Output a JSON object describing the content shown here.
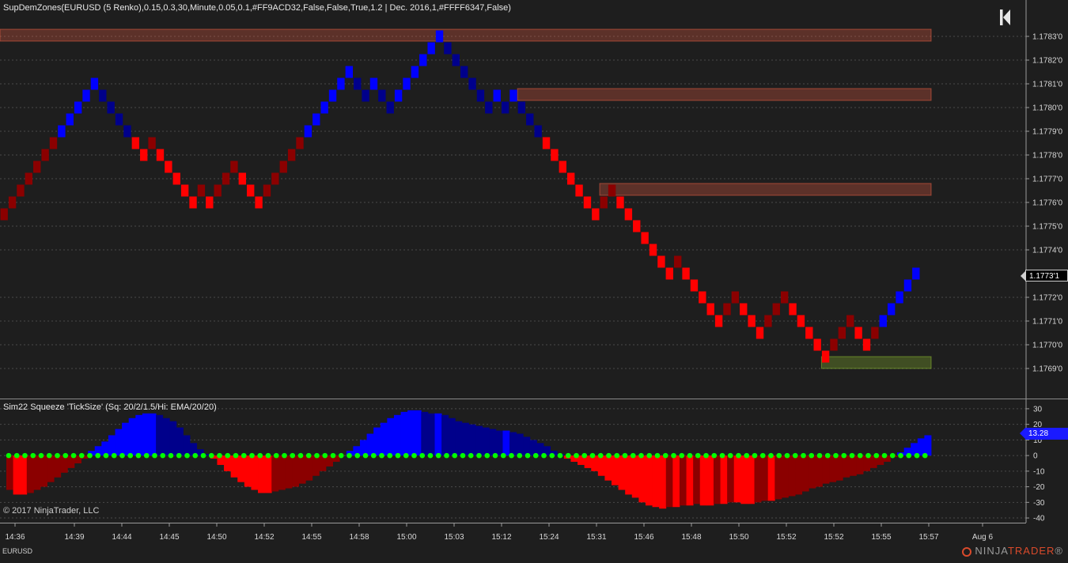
{
  "price_panel": {
    "title": "SupDemZones(EURUSD (5 Renko),0.15,0.3,30,Minute,0.05,0.1,#FF9ACD32,False,False,True,1.2 | Dec. 2016,1,#FFFF6347,False)",
    "y_ticks": [
      "1.1783'0",
      "1.1782'0",
      "1.1781'0",
      "1.1780'0",
      "1.1779'0",
      "1.1778'0",
      "1.1777'0",
      "1.1776'0",
      "1.1775'0",
      "1.1774'0",
      "1.1772'0",
      "1.1771'0",
      "1.1770'0",
      "1.1769'0"
    ],
    "current_price": "1.1773'1"
  },
  "indicator_panel": {
    "title": "Sim22 Squeeze  'TickSize' (Sq: 20/2/1.5/Hi: EMA/20/20)",
    "y_ticks": [
      "30",
      "20",
      "10",
      "0",
      "-10",
      "-20",
      "-30",
      "-40"
    ],
    "current_value": "13.28"
  },
  "x_ticks": [
    "14:36",
    "14:39",
    "14:44",
    "14:45",
    "14:50",
    "14:52",
    "14:55",
    "14:58",
    "15:00",
    "15:03",
    "15:12",
    "15:24",
    "15:31",
    "15:46",
    "15:48",
    "15:50",
    "15:52",
    "15:52",
    "15:55",
    "15:57",
    "Aug 6"
  ],
  "copyright": "© 2017 NinjaTrader, LLC",
  "symbol": "EURUSD",
  "brand": {
    "left": "NINJA",
    "right": "TRADER",
    "mark": "®"
  },
  "colors": {
    "background": "#1e1e1e",
    "up_strong": "#0000ff",
    "up_weak": "#00008b",
    "down_strong": "#ff0000",
    "down_weak": "#8b0000",
    "supply_zone": "#ff6347",
    "demand_zone": "#9acd32",
    "squeeze_dot": "#00ff00",
    "grid": "#4a4a4a"
  },
  "icons": {
    "nav": "skip-to-start-icon",
    "brand_logo": "ninjatrader-logo-icon"
  },
  "chart_data": [
    {
      "type": "renko",
      "title": "SupDemZones(EURUSD (5 Renko),0.15,0.3,30,Minute,0.05,0.1,#FF9ACD32,False,False,True,1.2 | Dec. 2016,1,#FFFF6347,False)",
      "brick_size_pips": 0.5,
      "ylim": [
        1.17685,
        1.17835
      ],
      "brick_path_mid": [
        1.17755,
        1.1776,
        1.17765,
        1.1777,
        1.17775,
        1.1778,
        1.17785,
        1.1779,
        1.17795,
        1.178,
        1.17805,
        1.1781,
        1.17805,
        1.178,
        1.17795,
        1.1779,
        1.17785,
        1.1778,
        1.17785,
        1.1778,
        1.17775,
        1.1777,
        1.17765,
        1.1776,
        1.17765,
        1.1776,
        1.17765,
        1.1777,
        1.17775,
        1.1777,
        1.17765,
        1.1776,
        1.17765,
        1.1777,
        1.17775,
        1.1778,
        1.17785,
        1.1779,
        1.17795,
        1.178,
        1.17805,
        1.1781,
        1.17815,
        1.1781,
        1.17805,
        1.1781,
        1.17805,
        1.178,
        1.17805,
        1.1781,
        1.17815,
        1.1782,
        1.17825,
        1.1783,
        1.17825,
        1.1782,
        1.17815,
        1.1781,
        1.17805,
        1.178,
        1.17805,
        1.178,
        1.17805,
        1.178,
        1.17795,
        1.1779,
        1.17785,
        1.1778,
        1.17775,
        1.1777,
        1.17765,
        1.1776,
        1.17755,
        1.1776,
        1.17765,
        1.1776,
        1.17755,
        1.1775,
        1.17745,
        1.1774,
        1.17735,
        1.1773,
        1.17735,
        1.1773,
        1.17725,
        1.1772,
        1.17715,
        1.1771,
        1.17715,
        1.1772,
        1.17715,
        1.1771,
        1.17705,
        1.1771,
        1.17715,
        1.1772,
        1.17715,
        1.1771,
        1.17705,
        1.177,
        1.17695,
        1.177,
        1.17705,
        1.1771,
        1.17705,
        1.177,
        1.17705,
        1.1771,
        1.17715,
        1.1772,
        1.17725,
        1.1773
      ],
      "zones": [
        {
          "kind": "supply",
          "from": 1.17828,
          "to": 1.17833,
          "start_index": 0
        },
        {
          "kind": "supply",
          "from": 1.17803,
          "to": 1.17808,
          "start_index": 63
        },
        {
          "kind": "supply",
          "from": 1.17763,
          "to": 1.17768,
          "start_index": 73
        },
        {
          "kind": "demand",
          "from": 1.1769,
          "to": 1.17695,
          "start_index": 100
        }
      ]
    },
    {
      "type": "bar",
      "title": "Sim22 Squeeze  'TickSize' (Sq: 20/2/1.5/Hi: EMA/20/20)",
      "ylim": [
        -42,
        33
      ],
      "values": [
        -22,
        -25,
        -25,
        -24,
        -22,
        -20,
        -17,
        -14,
        -11,
        -8,
        -5,
        -2,
        3,
        6,
        9,
        13,
        17,
        21,
        24,
        26,
        27,
        27,
        26,
        24,
        22,
        18,
        13,
        8,
        4,
        1,
        -2,
        -6,
        -10,
        -14,
        -17,
        -20,
        -22,
        -24,
        -24,
        -23,
        -22,
        -21,
        -20,
        -18,
        -16,
        -13,
        -10,
        -7,
        -4,
        0,
        3,
        6,
        10,
        14,
        18,
        21,
        24,
        26,
        28,
        29,
        29,
        28,
        27,
        27,
        26,
        24,
        22,
        21,
        20,
        19,
        18,
        17,
        16,
        16,
        15,
        14,
        12,
        10,
        8,
        6,
        3,
        1,
        -2,
        -4,
        -6,
        -8,
        -10,
        -13,
        -16,
        -19,
        -22,
        -25,
        -27,
        -30,
        -32,
        -33,
        -34,
        -33,
        -33,
        -32,
        -32,
        -31,
        -32,
        -32,
        -31,
        -31,
        -30,
        -30,
        -31,
        -31,
        -30,
        -29,
        -29,
        -28,
        -27,
        -26,
        -25,
        -23,
        -21,
        -20,
        -18,
        -17,
        -16,
        -14,
        -13,
        -12,
        -10,
        -8,
        -6,
        -4,
        -1,
        2,
        5,
        8,
        11,
        13
      ],
      "squeeze_dots_on_zero": true
    }
  ]
}
